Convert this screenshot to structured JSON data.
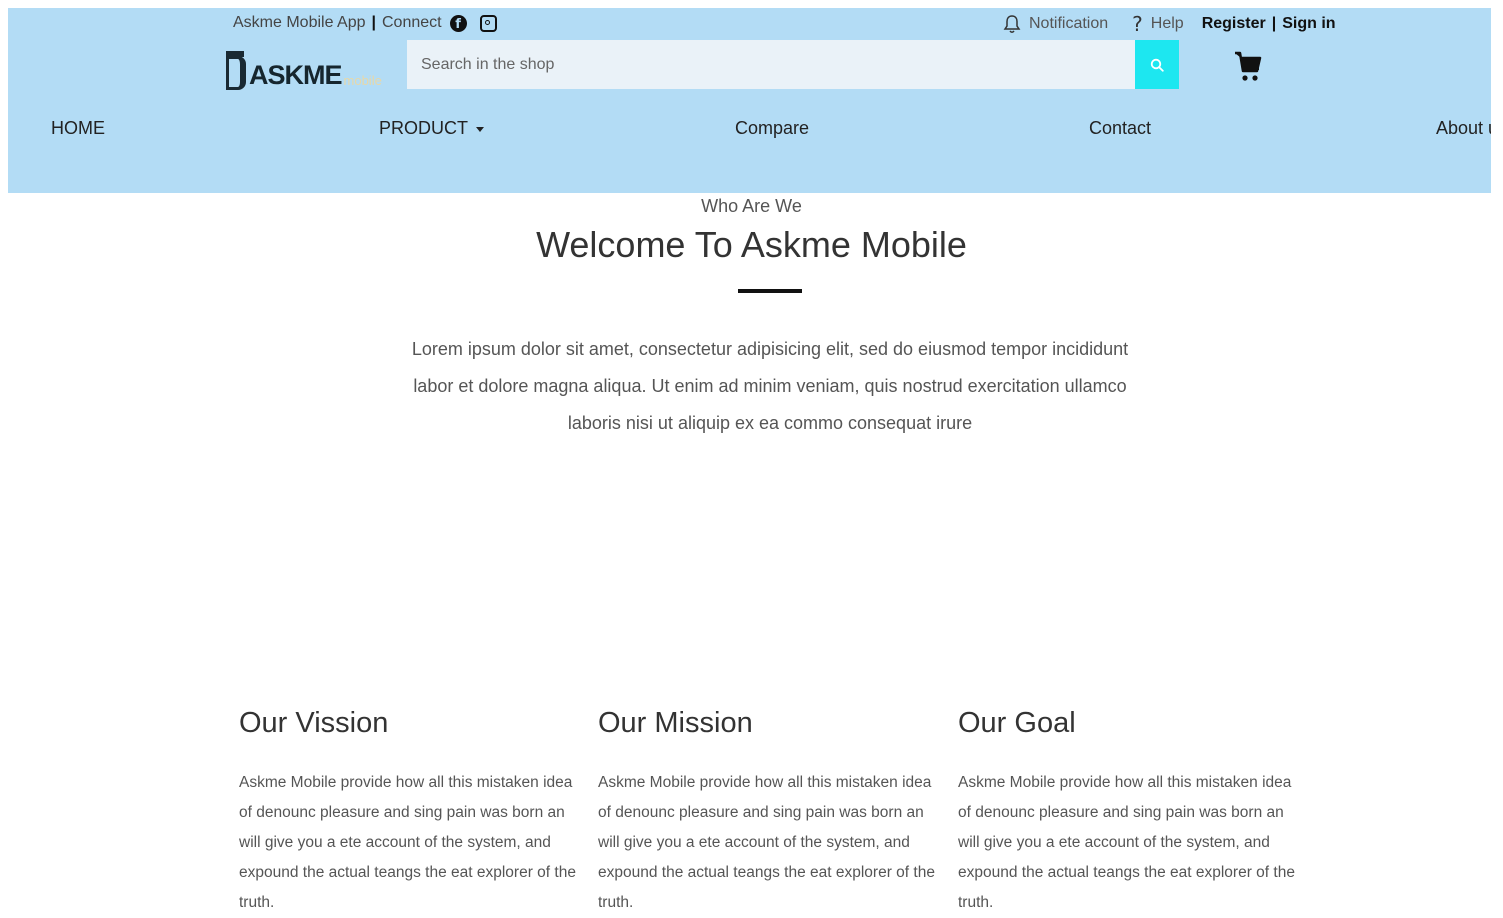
{
  "topbar": {
    "app_label": "Askme Mobile App",
    "divider": "|",
    "connect_label": "Connect",
    "notification_label": "Notification",
    "help_symbol": "?",
    "help_label": "Help",
    "register_label": "Register",
    "signin_label": "Sign in"
  },
  "logo": {
    "text": "ASKME",
    "sub": "mobile"
  },
  "search": {
    "placeholder": "Search in the shop",
    "value": ""
  },
  "nav": {
    "items": [
      {
        "label": "HOME"
      },
      {
        "label": "PRODUCT"
      },
      {
        "label": "Compare"
      },
      {
        "label": "Contact"
      },
      {
        "label": "About us"
      }
    ]
  },
  "about": {
    "kicker": "Who Are We",
    "title": "Welcome To Askme Mobile",
    "intro": "Lorem ipsum dolor sit amet, consectetur adipisicing elit, sed do eiusmod tempor incididunt labor et dolore magna aliqua. Ut enim ad minim veniam, quis nostrud exercitation ullamco laboris nisi ut aliquip ex ea commo consequat irure"
  },
  "cards": [
    {
      "title": "Our Vission",
      "text": "Askme Mobile provide how all this mistaken idea of denounc pleasure and sing pain was born an will give you a ete account of the system, and expound the actual teangs the eat explorer of the truth."
    },
    {
      "title": "Our Mission",
      "text": "Askme Mobile provide how all this mistaken idea of denounc pleasure and sing pain was born an will give you a ete account of the system, and expound the actual teangs the eat explorer of the truth."
    },
    {
      "title": "Our Goal",
      "text": "Askme Mobile provide how all this mistaken idea of denounc pleasure and sing pain was born an will give you a ete account of the system, and expound the actual teangs the eat explorer of the truth."
    }
  ],
  "colors": {
    "header_bg": "#b3dcf5",
    "search_button": "#1de7f0",
    "text_dark": "#333333"
  },
  "icons": {
    "facebook": "facebook-icon",
    "instagram": "instagram-icon",
    "bell": "bell-icon",
    "help": "help-icon",
    "search": "search-icon",
    "cart": "cart-icon"
  }
}
